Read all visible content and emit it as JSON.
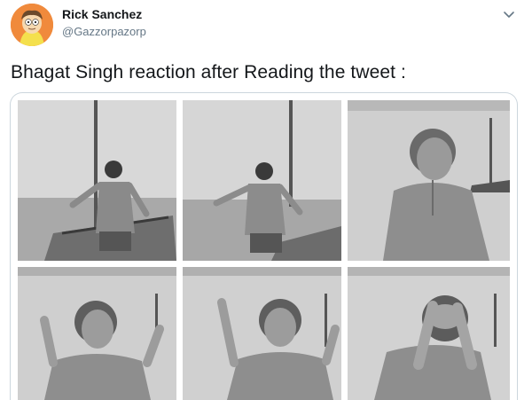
{
  "tweet": {
    "display_name": "Rick Sanchez",
    "handle": "@Gazzorpazorp",
    "text": "Bhagat Singh reaction after Reading the tweet :"
  },
  "icons": {
    "avatar": "rick-cartoon-avatar",
    "menu": "chevron-down-icon"
  },
  "media": {
    "panels": [
      {
        "id": "panel-1",
        "scene": "man-walking-on-riverbank",
        "tone": "grayscale"
      },
      {
        "id": "panel-2",
        "scene": "man-stepping-forward",
        "tone": "grayscale"
      },
      {
        "id": "panel-3",
        "scene": "man-head-tilted-back",
        "tone": "grayscale"
      },
      {
        "id": "panel-4",
        "scene": "man-hands-raised-crying",
        "tone": "grayscale"
      },
      {
        "id": "panel-5",
        "scene": "man-hands-up-lamenting",
        "tone": "grayscale"
      },
      {
        "id": "panel-6",
        "scene": "man-face-in-hands",
        "tone": "grayscale"
      }
    ]
  },
  "colors": {
    "text_primary": "#14171a",
    "text_secondary": "#657786",
    "border": "#ccd6dd",
    "avatar_bg": "#f08a3c"
  }
}
